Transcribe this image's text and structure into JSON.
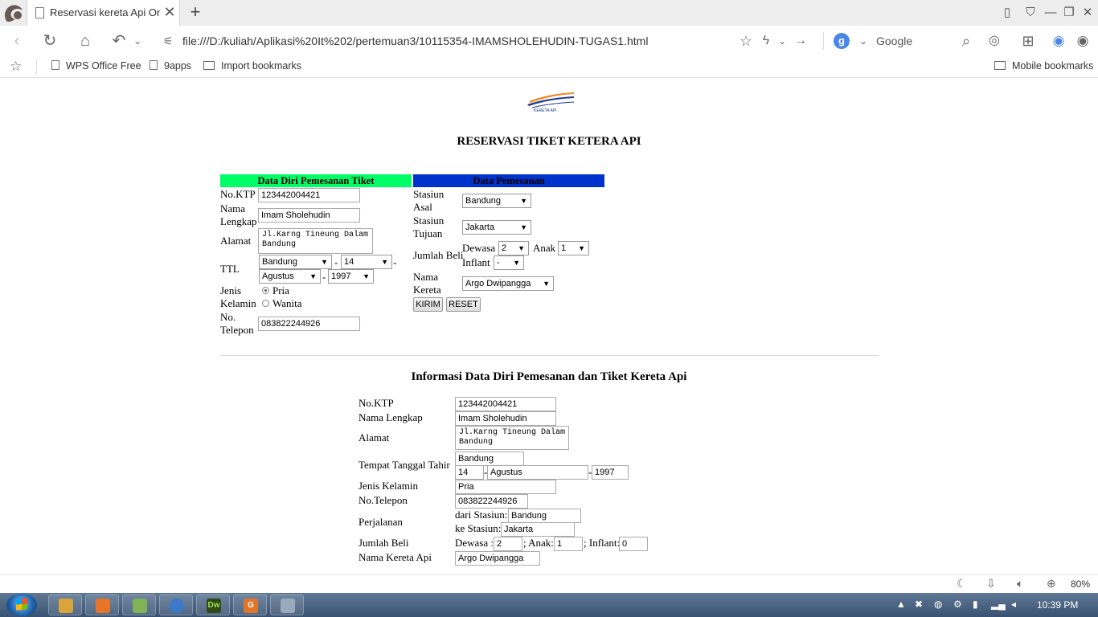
{
  "browser": {
    "tab_title": "Reservasi kereta Api Onlin",
    "tab_close": "✕",
    "new_tab": "+",
    "url": "file:///D:/kuliah/Aplikasi%20It%202/pertemuan3/10115354-IMAMSHOLEHUDIN-TUGAS1.html",
    "search_engine": "Google",
    "search_badge": "g",
    "bookmarks": [
      "WPS Office Free",
      "9apps",
      "Import bookmarks"
    ],
    "mobile_bookmarks": "Mobile bookmarks",
    "zoom": "80%"
  },
  "page": {
    "title": "RESERVASI TIKET KETERA API",
    "section_personal": "Data Diri Pemesanan Tiket",
    "section_booking": "Data Pemesanan",
    "colors": {
      "personal_header": "#00ff66",
      "booking_header": "#0033cc"
    },
    "form": {
      "ktp_label": "No.KTP",
      "ktp_value": "123442004421",
      "nama_label_1": "Nama",
      "nama_label_2": "Lengkap",
      "nama_value": "Imam Sholehudin",
      "alamat_label": "Alamat",
      "alamat_line1": "Jl.Karng Tineung Dalam",
      "alamat_line2": "Bandung",
      "ttl_label": "TTL",
      "ttl_place": "Bandung",
      "ttl_day": "14",
      "ttl_month": "Agustus",
      "ttl_year": "1997",
      "dash": "-",
      "jk_label_1": "Jenis",
      "jk_label_2": "Kelamin",
      "jk_option_1": "Pria",
      "jk_option_2": "Wanita",
      "telp_label_1": "No.",
      "telp_label_2": "Telepon",
      "telp_value": "083822244926",
      "asal_label_1": "Stasiun",
      "asal_label_2": "Asal",
      "asal_value": "Bandung",
      "tujuan_label_1": "Stasiun",
      "tujuan_label_2": "Tujuan",
      "tujuan_value": "Jakarta",
      "jumlah_label": "Jumlah Beli",
      "dewasa_label": "Dewasa",
      "dewasa_value": "2",
      "anak_label": "Anak",
      "anak_value": "1",
      "inflant_label": "Inflant",
      "inflant_value": "-",
      "kereta_label_1": "Nama",
      "kereta_label_2": "Kereta",
      "kereta_value": "Argo Dwipangga",
      "submit": "KIRIM",
      "reset": "RESET"
    },
    "info": {
      "title": "Informasi Data Diri Pemesanan dan Tiket Kereta Api",
      "ktp_label": "No.KTP",
      "ktp_value": "123442004421",
      "nama_label": "Nama Lengkap",
      "nama_value": "Imam Sholehudin",
      "alamat_label": "Alamat",
      "alamat_line1": "Jl.Karng Tineung Dalam",
      "alamat_line2": "Bandung",
      "ttl_label": "Tempat Tanggal Tahir",
      "ttl_place": "Bandung",
      "ttl_day": "14",
      "ttl_month": "Agustus",
      "ttl_year": "1997",
      "dash": "-",
      "jk_label": "Jenis Kelamin",
      "jk_value": "Pria",
      "telp_label": "No.Telepon",
      "telp_value": "083822244926",
      "perjalanan_label": "Perjalanan",
      "dari_label": "dari Stasiun:",
      "dari_value": "Bandung",
      "ke_label": "ke Stasiun:",
      "ke_value": "Jakarta",
      "jumlah_label": "Jumlah Beli",
      "dewasa_label": "Dewasa :",
      "dewasa_value": "2",
      "anak_label": "; Anak:",
      "anak_value": "1",
      "inflant_label": "; Inflant:",
      "inflant_value": "0",
      "kereta_label": "Nama Kereta Api",
      "kereta_value": "Argo Dwipangga"
    }
  },
  "taskbar": {
    "clock": "10:39 PM"
  }
}
